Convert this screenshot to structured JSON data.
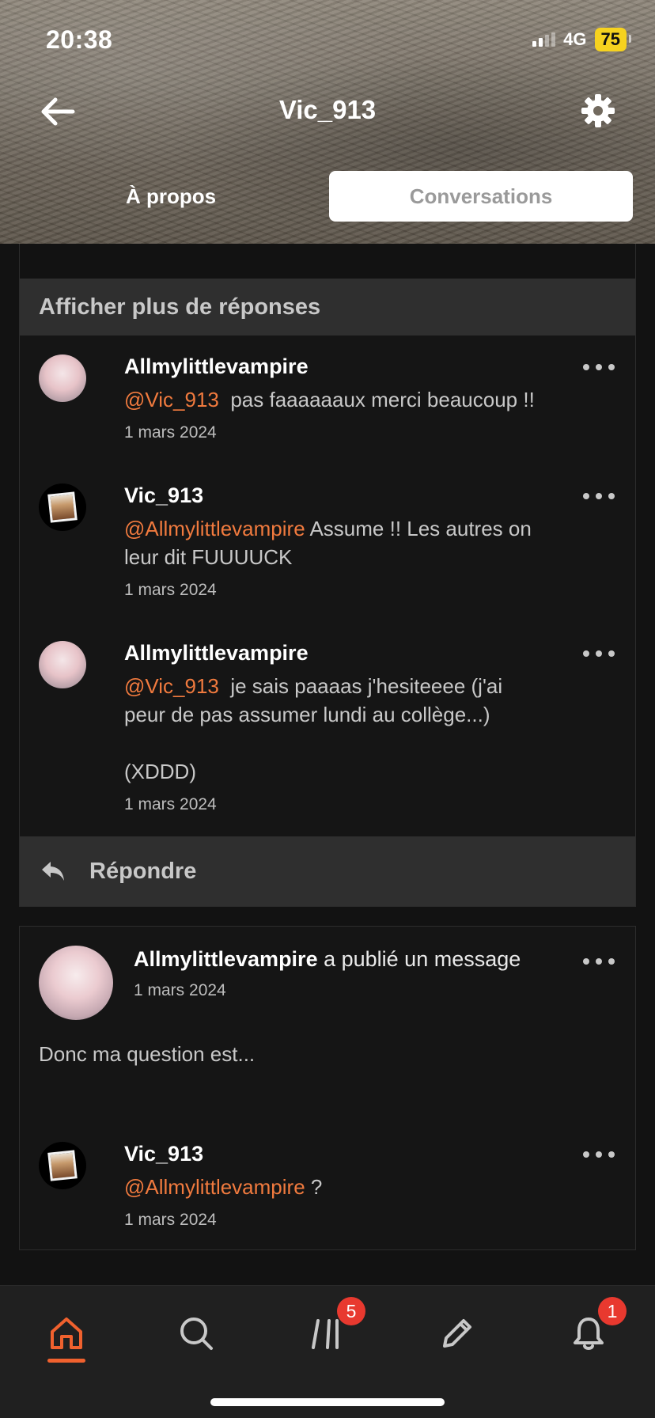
{
  "status_bar": {
    "time": "20:38",
    "network": "4G",
    "battery": "75"
  },
  "header": {
    "title": "Vic_913"
  },
  "tabs": [
    {
      "label": "À propos"
    },
    {
      "label": "Conversations"
    }
  ],
  "thread": {
    "more_replies_label": "Afficher plus de réponses",
    "comments": [
      {
        "author": "Allmylittlevampire",
        "mention": "@Vic_913",
        "text": "  pas faaaaaaux merci beaucoup !!",
        "date": "1 mars 2024"
      },
      {
        "author": "Vic_913",
        "mention": "@Allmylittlevampire",
        "text": " Assume !! Les autres on leur dit FUUUUCK",
        "date": "1 mars 2024"
      },
      {
        "author": "Allmylittlevampire",
        "mention": "@Vic_913",
        "text": "  je sais paaaas j'hesiteeee (j'ai peur de pas assumer lundi au collège...)\n\n(XDDD)",
        "date": "1 mars 2024"
      }
    ],
    "reply_label": "Répondre"
  },
  "post": {
    "author": "Allmylittlevampire",
    "action": " a publié un message",
    "date": "1 mars 2024",
    "text": "Donc ma question est...",
    "comment": {
      "author": "Vic_913",
      "mention": "@Allmylittlevampire",
      "text": " ?",
      "date": "1 mars 2024"
    }
  },
  "bottom_nav": {
    "items": [
      {
        "icon": "home-icon"
      },
      {
        "icon": "search-icon"
      },
      {
        "icon": "library-icon",
        "badge": "5"
      },
      {
        "icon": "pencil-icon"
      },
      {
        "icon": "bell-icon",
        "badge": "1"
      }
    ]
  },
  "colors": {
    "accent": "#f0612e",
    "mention": "#f07a3e",
    "badge": "#e8392f",
    "battery": "#f6d21f"
  }
}
